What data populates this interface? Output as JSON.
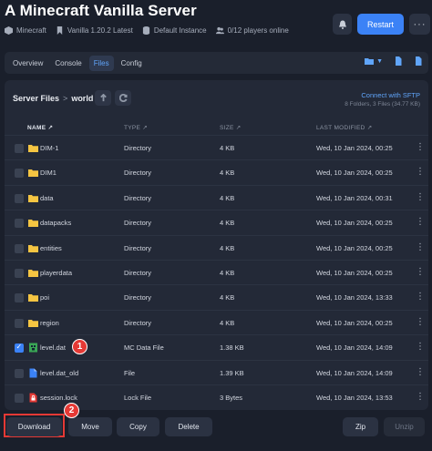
{
  "header": {
    "title": "A Minecraft Vanilla Server",
    "meta": [
      {
        "icon": "cube-icon",
        "text": "Minecraft"
      },
      {
        "icon": "bookmark-icon",
        "text": "Vanilla 1.20.2 Latest"
      },
      {
        "icon": "database-icon",
        "text": "Default Instance"
      },
      {
        "icon": "users-icon",
        "text": "0/12 players online"
      }
    ],
    "restart_label": "Restart",
    "more_label": "···"
  },
  "tabs": {
    "items": [
      "Overview",
      "Console",
      "Files",
      "Config"
    ],
    "active": "Files"
  },
  "files": {
    "breadcrumb_root": "Server Files",
    "breadcrumb_sep": ">",
    "breadcrumb_current": "world",
    "connect_label": "Connect with SFTP",
    "count_text": "8 Folders, 3 Files (34.77 KB)",
    "columns": {
      "name": "NAME ↗",
      "type": "TYPE ↗",
      "size": "SIZE ↗",
      "modified": "LAST MODIFIED ↗"
    },
    "rows": [
      {
        "name": "DIM-1",
        "type": "Directory",
        "size": "4 KB",
        "modified": "Wed, 10 Jan 2024, 00:25",
        "icon": "folder-icon",
        "checked": false
      },
      {
        "name": "DIM1",
        "type": "Directory",
        "size": "4 KB",
        "modified": "Wed, 10 Jan 2024, 00:25",
        "icon": "folder-icon",
        "checked": false
      },
      {
        "name": "data",
        "type": "Directory",
        "size": "4 KB",
        "modified": "Wed, 10 Jan 2024, 00:31",
        "icon": "folder-icon",
        "checked": false
      },
      {
        "name": "datapacks",
        "type": "Directory",
        "size": "4 KB",
        "modified": "Wed, 10 Jan 2024, 00:25",
        "icon": "folder-icon",
        "checked": false
      },
      {
        "name": "entities",
        "type": "Directory",
        "size": "4 KB",
        "modified": "Wed, 10 Jan 2024, 00:25",
        "icon": "folder-icon",
        "checked": false
      },
      {
        "name": "playerdata",
        "type": "Directory",
        "size": "4 KB",
        "modified": "Wed, 10 Jan 2024, 00:25",
        "icon": "folder-icon",
        "checked": false
      },
      {
        "name": "poi",
        "type": "Directory",
        "size": "4 KB",
        "modified": "Wed, 10 Jan 2024, 13:33",
        "icon": "folder-icon",
        "checked": false
      },
      {
        "name": "region",
        "type": "Directory",
        "size": "4 KB",
        "modified": "Wed, 10 Jan 2024, 00:25",
        "icon": "folder-icon",
        "checked": false
      },
      {
        "name": "level.dat",
        "type": "MC Data File",
        "size": "1.38 KB",
        "modified": "Wed, 10 Jan 2024, 14:09",
        "icon": "mc-file-icon",
        "checked": true
      },
      {
        "name": "level.dat_old",
        "type": "File",
        "size": "1.39 KB",
        "modified": "Wed, 10 Jan 2024, 14:09",
        "icon": "file-icon",
        "checked": false
      },
      {
        "name": "session.lock",
        "type": "Lock File",
        "size": "3 Bytes",
        "modified": "Wed, 10 Jan 2024, 13:53",
        "icon": "lock-file-icon",
        "checked": false
      }
    ],
    "kebab": "⋮"
  },
  "footer": {
    "download": "Download",
    "move": "Move",
    "copy": "Copy",
    "delete": "Delete",
    "zip": "Zip",
    "unzip": "Unzip"
  },
  "markers": {
    "one": "1",
    "two": "2"
  },
  "colors": {
    "accent": "#3b82f6",
    "folder": "#f5c542",
    "annotation": "#e53935"
  }
}
